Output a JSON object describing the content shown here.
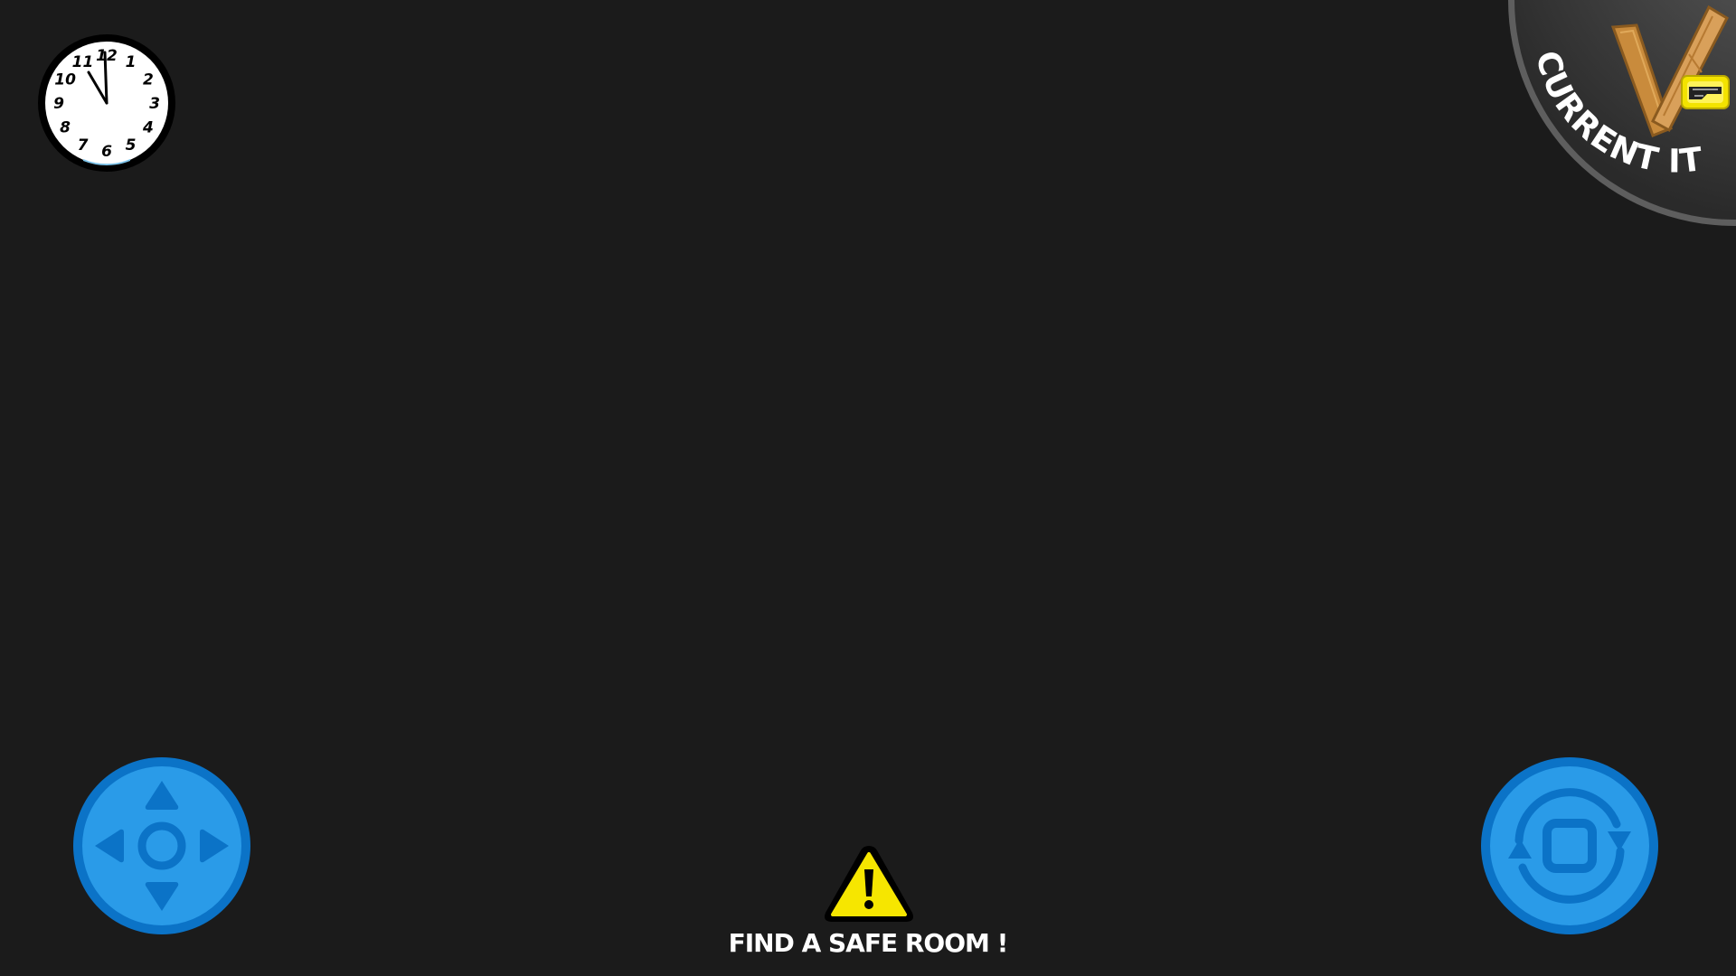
{
  "clock": {
    "numerals": [
      "12",
      "1",
      "2",
      "3",
      "4",
      "5",
      "6",
      "7",
      "8",
      "9",
      "10",
      "11"
    ],
    "time": "11:58"
  },
  "current_item": {
    "label": "CURRENT ITEM",
    "item_icon": "wooden-planks-icon",
    "badge_icon": "tape-icon"
  },
  "controls": {
    "move_icon": "dpad-icon",
    "action_icon": "rotate-action-icon"
  },
  "objective": {
    "icon": "warning-icon",
    "text": "FIND A SAFE ROOM !"
  },
  "colors": {
    "background": "#1b1b1b",
    "button_outer": "#0b73c7",
    "button_inner": "#2a9be8",
    "warning_yellow": "#f6e600",
    "panel_gray": "#474747"
  }
}
